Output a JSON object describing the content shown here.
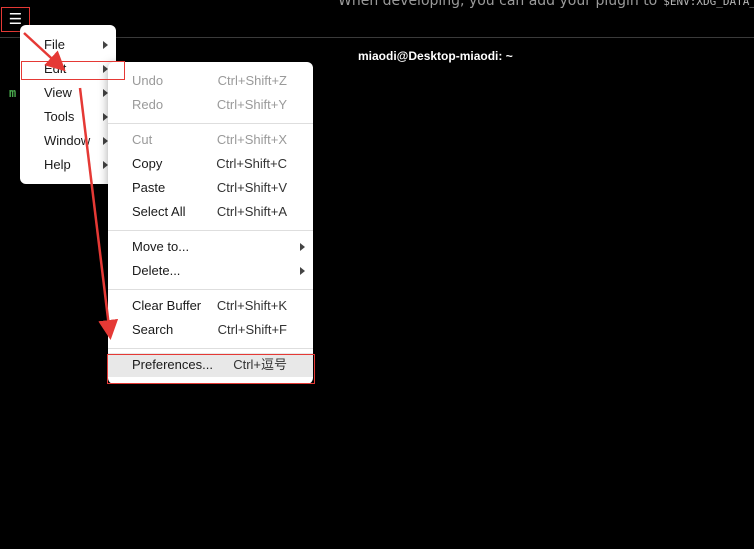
{
  "banner": {
    "text": "When developing, you can add your plugin to",
    "code": "$ENV:XDG_DATA_HO"
  },
  "terminal": {
    "title": "miaodi@Desktop-miaodi: ~",
    "prompt_fragment": "m"
  },
  "main_menu": {
    "items": [
      {
        "label": "File"
      },
      {
        "label": "Edit"
      },
      {
        "label": "View"
      },
      {
        "label": "Tools"
      },
      {
        "label": "Window"
      },
      {
        "label": "Help"
      }
    ]
  },
  "edit_menu": {
    "undo": {
      "label": "Undo",
      "shortcut": "Ctrl+Shift+Z"
    },
    "redo": {
      "label": "Redo",
      "shortcut": "Ctrl+Shift+Y"
    },
    "cut": {
      "label": "Cut",
      "shortcut": "Ctrl+Shift+X"
    },
    "copy": {
      "label": "Copy",
      "shortcut": "Ctrl+Shift+C"
    },
    "paste": {
      "label": "Paste",
      "shortcut": "Ctrl+Shift+V"
    },
    "select_all": {
      "label": "Select All",
      "shortcut": "Ctrl+Shift+A"
    },
    "move_to": {
      "label": "Move to..."
    },
    "delete": {
      "label": "Delete..."
    },
    "clear_buffer": {
      "label": "Clear Buffer",
      "shortcut": "Ctrl+Shift+K"
    },
    "search": {
      "label": "Search",
      "shortcut": "Ctrl+Shift+F"
    },
    "preferences": {
      "label": "Preferences...",
      "shortcut": "Ctrl+逗号"
    }
  },
  "colors": {
    "annotation_red": "#e53935",
    "menu_bg": "#ffffff",
    "hover_bg": "#e8e8e8",
    "disabled_text": "#9a9a9a",
    "prompt_green": "#4caf50"
  }
}
